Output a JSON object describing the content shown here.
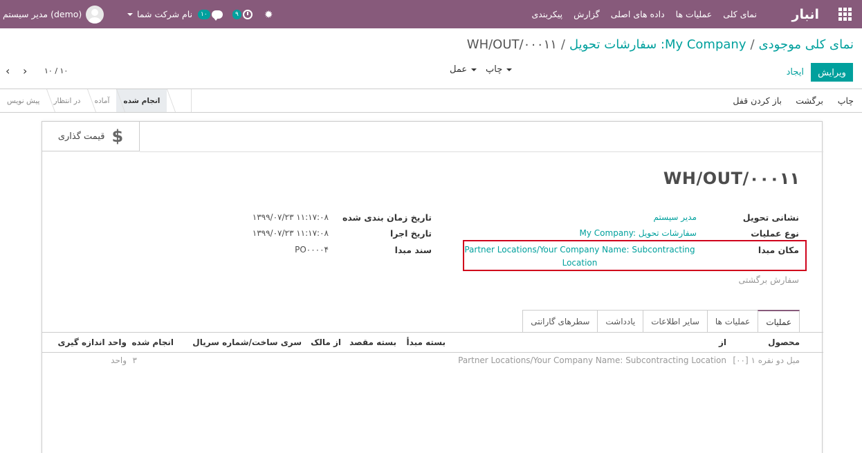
{
  "navbar": {
    "brand": "انبار",
    "menu": [
      "نمای کلی",
      "عملیات ها",
      "داده های اصلی",
      "گزارش",
      "پیکربندی"
    ],
    "clock_badge": "۹",
    "chat_badge": "۱۰",
    "company": "نام شرکت شما",
    "user": "مدیر سیستم (demo)"
  },
  "breadcrumb": {
    "crumb1": "نمای کلی موجودی",
    "sep": "/",
    "crumb2": "My Company: سفارشات تحویل",
    "current": "WH/OUT/۰۰۰۱۱"
  },
  "actions": {
    "edit": "ویرایش",
    "create": "ایجاد",
    "print": "چاپ",
    "action": "عمل",
    "pager": "۱۰ / ۱۰"
  },
  "statusbar": {
    "buttons": [
      "چاپ",
      "برگشت",
      "باز کردن قفل"
    ],
    "stages": [
      "انجام شده",
      "آماده",
      "در انتظار",
      "پیش نویس"
    ],
    "current_stage": "انجام شده"
  },
  "smart_button": {
    "label": "قیمت گذاری",
    "symbol": "$"
  },
  "record": {
    "name": "WH/OUT/۰۰۰۱۱",
    "delivery_address_label": "نشانی تحویل",
    "delivery_address": "مدیر سیستم",
    "operation_type_label": "نوع عملیات",
    "operation_type": "My Company: سفارشات تحویل",
    "source_location_label": "مکان مبدا",
    "source_location_line1": "Partner Locations/Your Company Name: Subcontracting",
    "source_location_line2": "Location",
    "return_order_label": "سفارش برگشتی",
    "scheduled_date_label": "تاریخ زمان بندی شده",
    "scheduled_date": "۱۳۹۹/۰۷/۲۳ ۱۱:۱۷:۰۸",
    "effective_date_label": "تاریخ اجرا",
    "effective_date": "۱۳۹۹/۰۷/۲۳ ۱۱:۱۷:۰۸",
    "source_doc_label": "سند مبدا",
    "source_doc": "PO۰۰۰۰۴"
  },
  "tabs": [
    "عملیات",
    "عملیات ها",
    "سایر اطلاعات",
    "یادداشت",
    "سطرهای گارانتی"
  ],
  "table": {
    "headers": {
      "product": "محصول",
      "from": "از",
      "source_package": "بسته مبدأ",
      "dest_package": "بسته مقصد",
      "owner": "از مالک",
      "lot": "سری ساخت/شماره سریال",
      "done": "انجام شده",
      "uom": "واحد اندازه گیری"
    },
    "rows": [
      {
        "product": "[۰۰] مبل دو نفره ۱",
        "from": "Partner Locations/Your Company Name: Subcontracting Location",
        "done": "۳",
        "uom": "واحد"
      }
    ]
  }
}
